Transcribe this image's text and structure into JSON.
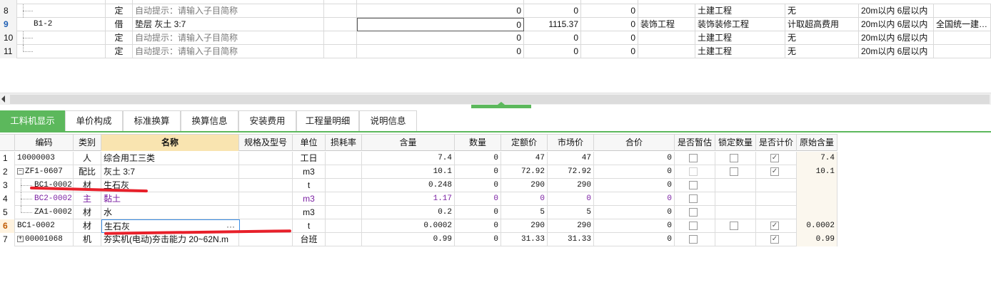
{
  "top_grid": {
    "rows": [
      {
        "no": "8",
        "code": "",
        "type": "定",
        "name": "自动提示：请输入子目简称",
        "is_hint": true,
        "v1": "0",
        "v2": "0",
        "v3": "0",
        "col_a": "",
        "col_b": "土建工程",
        "col_c": "无",
        "col_d": "20m以内 6层以内",
        "col_e": ""
      },
      {
        "no": "9",
        "code": "B1-2",
        "type": "借",
        "name": "垫层 灰土 3:7",
        "is_hint": false,
        "v1": "0",
        "v2": "1115.37",
        "v3": "0",
        "col_a": "装饰工程",
        "col_b": "装饰装修工程",
        "col_c": "计取超高费用",
        "col_d": "20m以内 6层以内",
        "col_e": "全国统一建…"
      },
      {
        "no": "10",
        "code": "",
        "type": "定",
        "name": "自动提示：请输入子目简称",
        "is_hint": true,
        "v1": "0",
        "v2": "0",
        "v3": "0",
        "col_a": "",
        "col_b": "土建工程",
        "col_c": "无",
        "col_d": "20m以内 6层以内",
        "col_e": ""
      },
      {
        "no": "11",
        "code": "",
        "type": "定",
        "name": "自动提示：请输入子目简称",
        "is_hint": true,
        "v1": "0",
        "v2": "0",
        "v3": "0",
        "col_a": "",
        "col_b": "土建工程",
        "col_c": "无",
        "col_d": "20m以内 6层以内",
        "col_e": ""
      }
    ]
  },
  "tabs": [
    "工料机显示",
    "单价构成",
    "标准换算",
    "换算信息",
    "安装费用",
    "工程量明细",
    "说明信息"
  ],
  "active_tab": "工料机显示",
  "bottom_grid": {
    "headers": [
      "编码",
      "类别",
      "名称",
      "规格及型号",
      "单位",
      "损耗率",
      "含量",
      "数量",
      "定额价",
      "市场价",
      "合价",
      "是否暂估",
      "锁定数量",
      "是否计价",
      "原始含量"
    ],
    "rows": [
      {
        "no": "1",
        "code": "10000003",
        "type": "人",
        "name": "综合用工三类",
        "spec": "",
        "unit": "工日",
        "loss": "",
        "qty_ratio": "7.4",
        "qty": "0",
        "base_price": "47",
        "market_price": "47",
        "total": "0",
        "provisional": false,
        "locked": false,
        "priced": true,
        "orig": "7.4"
      },
      {
        "no": "2",
        "code": "ZF1-0607",
        "type": "配比",
        "name": "灰土 3:7",
        "spec": "",
        "unit": "m3",
        "loss": "",
        "qty_ratio": "10.1",
        "qty": "0",
        "base_price": "72.92",
        "market_price": "72.92",
        "total": "0",
        "provisional": false,
        "locked": false,
        "priced": true,
        "orig": "10.1",
        "expander": "−"
      },
      {
        "no": "3",
        "code": "BC1-0002",
        "type": "材",
        "name": "生石灰",
        "spec": "",
        "unit": "t",
        "loss": "",
        "qty_ratio": "0.248",
        "qty": "0",
        "base_price": "290",
        "market_price": "290",
        "total": "0",
        "provisional": false
      },
      {
        "no": "4",
        "code": "BC2-0002",
        "type": "主",
        "name": "黏土",
        "spec": "",
        "unit": "m3",
        "loss": "",
        "qty_ratio": "1.17",
        "qty": "0",
        "base_price": "0",
        "market_price": "0",
        "total": "0",
        "provisional": false,
        "purple": true
      },
      {
        "no": "5",
        "code": "ZA1-0002",
        "type": "材",
        "name": "水",
        "spec": "",
        "unit": "m3",
        "loss": "",
        "qty_ratio": "0.2",
        "qty": "0",
        "base_price": "5",
        "market_price": "5",
        "total": "0",
        "provisional": false
      },
      {
        "no": "6",
        "code": "BC1-0002",
        "type": "材",
        "name": "生石灰",
        "spec": "",
        "unit": "t",
        "loss": "",
        "qty_ratio": "0.0002",
        "qty": "0",
        "base_price": "290",
        "market_price": "290",
        "total": "0",
        "provisional": false,
        "locked": false,
        "priced": true,
        "orig": "0.0002"
      },
      {
        "no": "7",
        "code": "00001068",
        "type": "机",
        "name": "夯实机(电动)夯击能力 20~62N.m",
        "spec": "",
        "unit": "台班",
        "loss": "",
        "qty_ratio": "0.99",
        "qty": "0",
        "base_price": "31.33",
        "market_price": "31.33",
        "total": "0",
        "provisional": false,
        "priced": true,
        "orig": "0.99",
        "expander": "+"
      }
    ],
    "ellipsis": "···"
  },
  "colors": {
    "tab_green": "#5cb85c",
    "name_header_highlight": "#f9e4b0",
    "main_material_purple": "#7a1fa2",
    "annotation_red": "#e8202a"
  }
}
